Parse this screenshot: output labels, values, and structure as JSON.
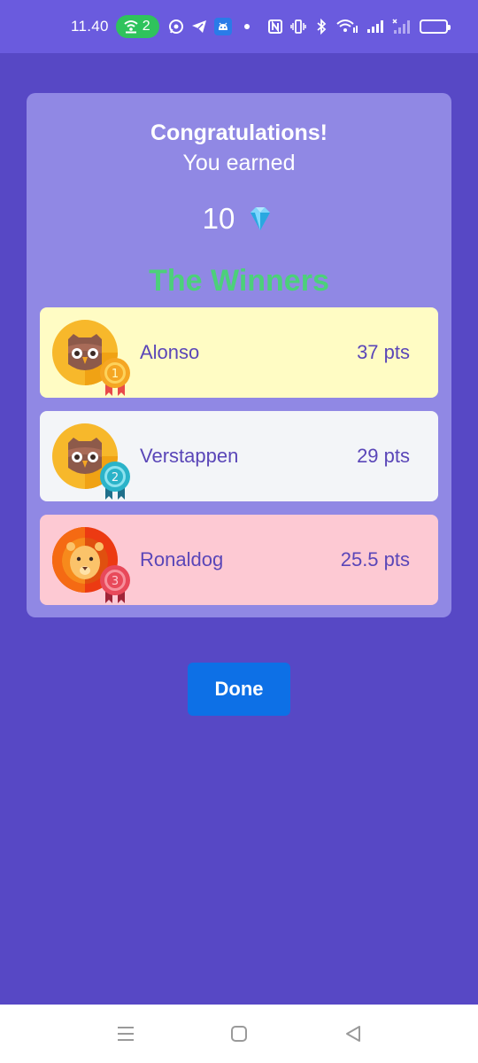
{
  "status_bar": {
    "time": "11.40",
    "hotspot_count": "2",
    "icons": [
      "hotspot-icon",
      "whatsapp-icon",
      "telegram-icon",
      "android-app-icon",
      "notification-dot",
      "nfc-icon",
      "vibrate-icon",
      "bluetooth-icon",
      "wifi-icon",
      "signal-icon",
      "signal-no-sim-icon",
      "battery-icon"
    ]
  },
  "reward": {
    "heading": "Congratulations!",
    "subheading": "You earned",
    "amount": "10",
    "gem_icon": "diamond-icon"
  },
  "winners": {
    "title": "The Winners",
    "title_color": "#4cd07a",
    "rows": [
      {
        "rank": "1",
        "name": "Alonso",
        "points": "37 pts",
        "avatar": "owl-avatar",
        "background": "#fffcc4",
        "medal_color": "#f5a623"
      },
      {
        "rank": "2",
        "name": "Verstappen",
        "points": "29 pts",
        "avatar": "owl-avatar",
        "background": "#f3f5f8",
        "medal_color": "#2bb3c9"
      },
      {
        "rank": "3",
        "name": "Ronaldog",
        "points": "25.5 pts",
        "avatar": "lion-avatar",
        "background": "#fdc9d3",
        "medal_color": "#e8495a"
      }
    ]
  },
  "actions": {
    "done_label": "Done",
    "done_color": "#0d70e6"
  },
  "nav_bar": {
    "buttons": [
      "menu-icon",
      "home-icon",
      "back-icon"
    ]
  },
  "colors": {
    "background": "#5748c5",
    "status_bar": "#6a5bde",
    "card": "#9088e4",
    "text_accent": "#5a46b8"
  }
}
